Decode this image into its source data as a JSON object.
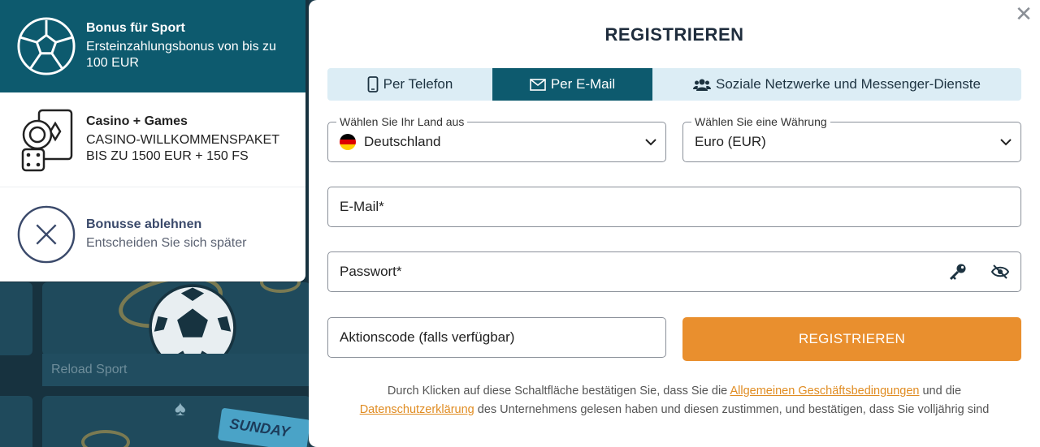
{
  "background": {
    "reload_label": "Reload Sport",
    "ticket_label": "SUNDAY"
  },
  "bonuses": {
    "sport": {
      "title": "Bonus für Sport",
      "desc": "Ersteinzahlungsbonus von bis zu 100 EUR",
      "icon": "soccer-ball-icon"
    },
    "casino": {
      "title": "Casino + Games",
      "desc_line1": "CASINO-WILLKOMMENSPAKET",
      "desc_line2": "BIS ZU 1500 EUR + 150 FS",
      "icon": "casino-chips-dice-icon"
    },
    "decline": {
      "title": "Bonusse ablehnen",
      "desc": "Entscheiden Sie sich später",
      "icon": "close-circle-icon"
    }
  },
  "modal": {
    "title": "REGISTRIEREN",
    "close_glyph": "✕",
    "tabs": [
      {
        "label": "Per Telefon",
        "icon": "phone-icon",
        "active": false
      },
      {
        "label": "Per E-Mail",
        "icon": "envelope-icon",
        "active": true
      },
      {
        "label": "Soziale Netzwerke und Messenger-Dienste",
        "icon": "users-icon",
        "active": false
      }
    ],
    "country": {
      "legend": "Wählen Sie Ihr Land aus",
      "value": "Deutschland"
    },
    "currency": {
      "legend": "Wählen Sie eine Währung",
      "value": "Euro (EUR)"
    },
    "email": {
      "placeholder": "E-Mail*"
    },
    "password": {
      "placeholder": "Passwort*"
    },
    "promo": {
      "placeholder": "Aktionscode (falls verfügbar)"
    },
    "submit_label": "REGISTRIEREN",
    "terms": {
      "part1": "Durch Klicken auf diese Schaltfläche bestätigen Sie, dass Sie die ",
      "link1": "Allgemeinen Geschäftsbedingungen",
      "part2": " und die ",
      "link2": "Datenschutzerklärung",
      "part3": " des Unternehmens gelesen haben und diesen zustimmen, und bestätigen, dass Sie volljährig sind"
    }
  },
  "colors": {
    "brand_teal": "#0d5a6e",
    "accent_orange": "#e98f2e",
    "tab_bg": "#dcedf5"
  }
}
